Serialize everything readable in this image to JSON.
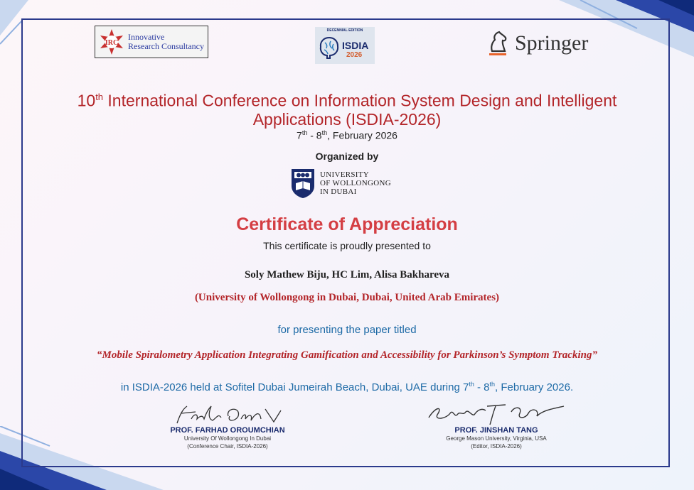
{
  "logos": {
    "irc": {
      "line1": "Innovative",
      "line2": "Research Consultancy",
      "emblem": "IRC"
    },
    "isdia": {
      "top": "DECENNIAL EDITION",
      "name": "ISDIA",
      "year": "2026"
    },
    "springer": {
      "name": "Springer"
    }
  },
  "conference": {
    "title_line1_pre": "10",
    "title_line1_sup": "th",
    "title_line1_post": " International Conference on Information System Design and Intelligent",
    "title_line2": "Applications (ISDIA-2026)",
    "date_d1": "7",
    "date_sup1": "th",
    "date_mid": " - 8",
    "date_sup2": "th",
    "date_post": ", February 2026"
  },
  "organizer": {
    "label": "Organized by",
    "line1": "UNIVERSITY",
    "line2": "OF WOLLONGONG",
    "line3": "IN DUBAI"
  },
  "certificate": {
    "title": "Certificate of Appreciation",
    "presented": "This certificate is proudly presented to",
    "recipients": "Soly Mathew Biju, HC Lim, Alisa Bakhareva",
    "affiliation": "(University of Wollongong in Dubai, Dubai, United Arab Emirates)",
    "for_presenting": "for presenting the paper titled",
    "paper_title": "“Mobile Spiralometry Application Integrating Gamification and Accessibility for Parkinson’s Symptom Tracking”",
    "held_pre": "in ISDIA-2026 held at Sofitel Dubai Jumeirah Beach, Dubai, UAE during 7",
    "held_sup1": "th",
    "held_mid": " - 8",
    "held_sup2": "th",
    "held_post": ", February 2026."
  },
  "signatures": [
    {
      "name": "PROF. FARHAD OROUMCHIAN",
      "line1": "University Of Wollongong In Dubai",
      "line2": "(Conference Chair, ISDIA-2026)"
    },
    {
      "name": "PROF. JINSHAN TANG",
      "line1": "George Mason University, Virginia, USA",
      "line2": "(Editor, ISDIA-2026)"
    }
  ],
  "colors": {
    "frame": "#2b3a8c",
    "accent_red": "#b32529",
    "accent_blue": "#1d6aa6"
  }
}
